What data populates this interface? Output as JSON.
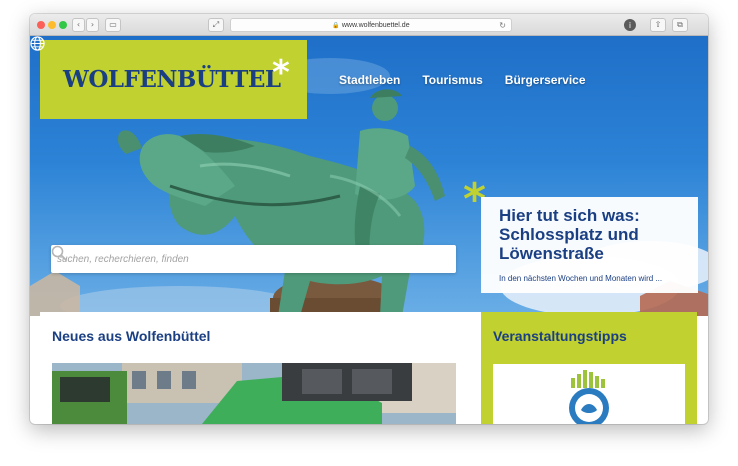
{
  "browser": {
    "url": "www.wolfenbuettel.de",
    "back_icon": "chevron-left-icon",
    "forward_icon": "chevron-right-icon"
  },
  "site": {
    "logo_text": "WOLFENBÜTTEL",
    "logo_star": "*",
    "brand_green": "#c0d130",
    "brand_blue": "#1b3f83"
  },
  "nav": {
    "items": [
      "Stadtleben",
      "Tourismus",
      "Bürgerservice"
    ],
    "language_icon": "globe-icon"
  },
  "search": {
    "placeholder": "suchen, recherchieren, finden",
    "value": ""
  },
  "feature": {
    "star": "*",
    "title": "Hier tut sich was: Schlossplatz und Löwenstraße",
    "teaser": "In den nächsten Wochen und Monaten wird ..."
  },
  "news": {
    "heading": "Neues aus Wolfenbüttel"
  },
  "events": {
    "heading": "Veranstaltungstipps"
  }
}
